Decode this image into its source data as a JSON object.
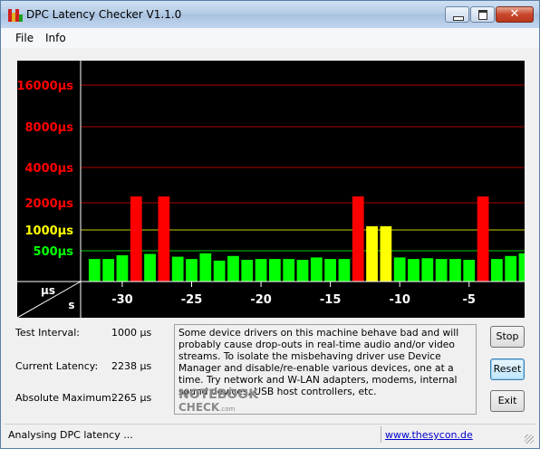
{
  "window": {
    "title": "DPC Latency Checker V1.1.0",
    "close_glyph": "✕"
  },
  "menu": {
    "file": "File",
    "info": "Info"
  },
  "chart_data": {
    "type": "bar",
    "y_tick_labels": [
      {
        "text": "16000µs",
        "color": "#ff0000"
      },
      {
        "text": "8000µs",
        "color": "#ff0000"
      },
      {
        "text": "4000µs",
        "color": "#ff0000"
      },
      {
        "text": "2000µs",
        "color": "#ff0000"
      },
      {
        "text": "1000µs",
        "color": "#ffff00"
      },
      {
        "text": "500µs",
        "color": "#00ff00"
      }
    ],
    "x_tick_labels": [
      "-30",
      "-25",
      "-20",
      "-15",
      "-10",
      "-5"
    ],
    "x_ticks": [
      -30,
      -25,
      -20,
      -15,
      -10,
      -5
    ],
    "corner_unit_y": "µs",
    "corner_unit_x": "s",
    "xlim": [
      -33,
      -1
    ],
    "ylog_ticks": [
      16000,
      8000,
      4000,
      2000,
      1000,
      500
    ],
    "colors": {
      "green": "#00ff00",
      "yellow": "#ffff00",
      "red": "#ff0000",
      "grid_red": "#aa0000",
      "grid_yellow": "#cccc00",
      "grid_green": "#00cc00",
      "axis": "#ffffff"
    },
    "x": [
      -32,
      -31,
      -30,
      -29,
      -28,
      -27,
      -26,
      -25,
      -24,
      -23,
      -22,
      -21,
      -20,
      -19,
      -18,
      -17,
      -16,
      -15,
      -14,
      -13,
      -12,
      -11,
      -10,
      -9,
      -8,
      -7,
      -6,
      -5,
      -4,
      -3,
      -2,
      -1
    ],
    "values": [
      380,
      380,
      430,
      2265,
      450,
      2265,
      410,
      380,
      460,
      360,
      420,
      370,
      380,
      380,
      380,
      370,
      400,
      380,
      380,
      2265,
      1100,
      1100,
      400,
      380,
      390,
      380,
      380,
      370,
      2265,
      380,
      420,
      460
    ],
    "bar_colors": [
      "green",
      "green",
      "green",
      "red",
      "green",
      "red",
      "green",
      "green",
      "green",
      "green",
      "green",
      "green",
      "green",
      "green",
      "green",
      "green",
      "green",
      "green",
      "green",
      "red",
      "yellow",
      "yellow",
      "green",
      "green",
      "green",
      "green",
      "green",
      "green",
      "red",
      "green",
      "green",
      "green"
    ]
  },
  "stats": [
    {
      "label": "Test Interval:",
      "value": "1000 µs"
    },
    {
      "label": "Current Latency:",
      "value": "2238 µs"
    },
    {
      "label": "Absolute Maximum:",
      "value": "2265 µs"
    }
  ],
  "info_text": "Some device drivers on this machine behave bad and will probably cause drop-outs in real-time audio and/or video streams. To isolate the misbehaving driver use Device Manager and disable/re-enable various devices, one at a time. Try network and W-LAN adapters, modems, internal sound devices, USB host controllers, etc.",
  "watermark": {
    "line1": "NOTEBOOK",
    "line2": "CHECK",
    "line2_suffix": ".com"
  },
  "buttons": {
    "stop": "Stop",
    "reset": "Reset",
    "exit": "Exit"
  },
  "status": {
    "text": "Analysing DPC latency ...",
    "link": "www.thesycon.de"
  }
}
